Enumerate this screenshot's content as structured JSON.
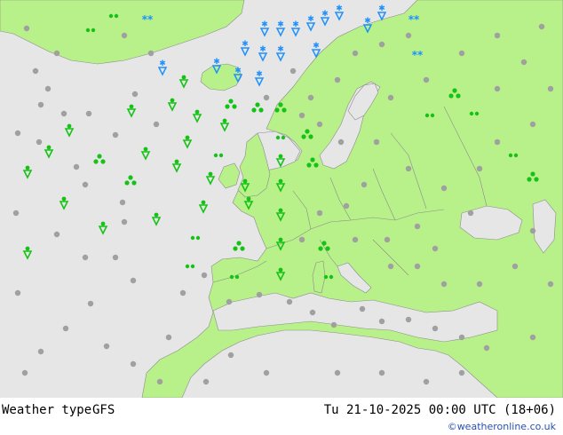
{
  "footer": {
    "parameter": "Weather type",
    "model": "GFS",
    "valid_time": "Tu 21-10-2025 00:00 UTC (18+06)",
    "copyright": "©weatheronline.co.uk"
  },
  "colors": {
    "sea": "#e6e6e6",
    "land": "#b8f08a",
    "border": "#8c8c8c",
    "rain_symbol": "#16c216",
    "snow_symbol": "#1e90ff",
    "dry_dot": "#a0a0a0"
  },
  "icons": [
    "rain-shower-icon",
    "drizzle-icon",
    "snow-icon",
    "thunder-shower-icon",
    "cloud-dot-icon"
  ]
}
